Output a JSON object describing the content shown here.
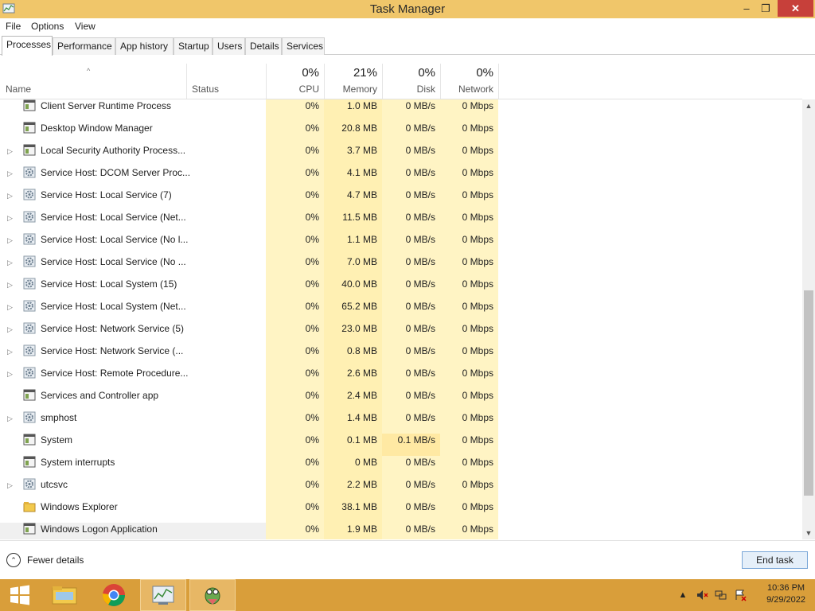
{
  "window": {
    "title": "Task Manager",
    "controls": {
      "minimize": "–",
      "maximize": "❐",
      "close": "✕"
    }
  },
  "menu": [
    "File",
    "Options",
    "View"
  ],
  "tabs": [
    "Processes",
    "Performance",
    "App history",
    "Startup",
    "Users",
    "Details",
    "Services"
  ],
  "columns": {
    "name": "Name",
    "status": "Status",
    "cpu": {
      "pct": "0%",
      "label": "CPU"
    },
    "memory": {
      "pct": "21%",
      "label": "Memory"
    },
    "disk": {
      "pct": "0%",
      "label": "Disk"
    },
    "network": {
      "pct": "0%",
      "label": "Network"
    }
  },
  "processes": [
    {
      "name": "Client Server Runtime Process",
      "cpu": "0%",
      "memory": "1.0 MB",
      "disk": "0 MB/s",
      "network": "0 Mbps",
      "expandable": false,
      "icon": "window-app-icon"
    },
    {
      "name": "Desktop Window Manager",
      "cpu": "0%",
      "memory": "20.8 MB",
      "disk": "0 MB/s",
      "network": "0 Mbps",
      "expandable": false,
      "icon": "window-app-icon"
    },
    {
      "name": "Local Security Authority Process...",
      "cpu": "0%",
      "memory": "3.7 MB",
      "disk": "0 MB/s",
      "network": "0 Mbps",
      "expandable": true,
      "icon": "window-app-icon"
    },
    {
      "name": "Service Host: DCOM Server Proc...",
      "cpu": "0%",
      "memory": "4.1 MB",
      "disk": "0 MB/s",
      "network": "0 Mbps",
      "expandable": true,
      "icon": "gear-icon"
    },
    {
      "name": "Service Host: Local Service (7)",
      "cpu": "0%",
      "memory": "4.7 MB",
      "disk": "0 MB/s",
      "network": "0 Mbps",
      "expandable": true,
      "icon": "gear-icon"
    },
    {
      "name": "Service Host: Local Service (Net...",
      "cpu": "0%",
      "memory": "11.5 MB",
      "disk": "0 MB/s",
      "network": "0 Mbps",
      "expandable": true,
      "icon": "gear-icon"
    },
    {
      "name": "Service Host: Local Service (No l...",
      "cpu": "0%",
      "memory": "1.1 MB",
      "disk": "0 MB/s",
      "network": "0 Mbps",
      "expandable": true,
      "icon": "gear-icon"
    },
    {
      "name": "Service Host: Local Service (No ...",
      "cpu": "0%",
      "memory": "7.0 MB",
      "disk": "0 MB/s",
      "network": "0 Mbps",
      "expandable": true,
      "icon": "gear-icon"
    },
    {
      "name": "Service Host: Local System (15)",
      "cpu": "0%",
      "memory": "40.0 MB",
      "disk": "0 MB/s",
      "network": "0 Mbps",
      "expandable": true,
      "icon": "gear-icon"
    },
    {
      "name": "Service Host: Local System (Net...",
      "cpu": "0%",
      "memory": "65.2 MB",
      "disk": "0 MB/s",
      "network": "0 Mbps",
      "expandable": true,
      "icon": "gear-icon"
    },
    {
      "name": "Service Host: Network Service (5)",
      "cpu": "0%",
      "memory": "23.0 MB",
      "disk": "0 MB/s",
      "network": "0 Mbps",
      "expandable": true,
      "icon": "gear-icon"
    },
    {
      "name": "Service Host: Network Service (...",
      "cpu": "0%",
      "memory": "0.8 MB",
      "disk": "0 MB/s",
      "network": "0 Mbps",
      "expandable": true,
      "icon": "gear-icon"
    },
    {
      "name": "Service Host: Remote Procedure...",
      "cpu": "0%",
      "memory": "2.6 MB",
      "disk": "0 MB/s",
      "network": "0 Mbps",
      "expandable": true,
      "icon": "gear-icon"
    },
    {
      "name": "Services and Controller app",
      "cpu": "0%",
      "memory": "2.4 MB",
      "disk": "0 MB/s",
      "network": "0 Mbps",
      "expandable": false,
      "icon": "window-app-icon"
    },
    {
      "name": "smphost",
      "cpu": "0%",
      "memory": "1.4 MB",
      "disk": "0 MB/s",
      "network": "0 Mbps",
      "expandable": true,
      "icon": "gear-icon"
    },
    {
      "name": "System",
      "cpu": "0%",
      "memory": "0.1 MB",
      "disk": "0.1 MB/s",
      "network": "0 Mbps",
      "expandable": false,
      "icon": "window-app-icon"
    },
    {
      "name": "System interrupts",
      "cpu": "0%",
      "memory": "0 MB",
      "disk": "0 MB/s",
      "network": "0 Mbps",
      "expandable": false,
      "icon": "window-app-icon"
    },
    {
      "name": "utcsvc",
      "cpu": "0%",
      "memory": "2.2 MB",
      "disk": "0 MB/s",
      "network": "0 Mbps",
      "expandable": true,
      "icon": "gear-icon"
    },
    {
      "name": "Windows Explorer",
      "cpu": "0%",
      "memory": "38.1 MB",
      "disk": "0 MB/s",
      "network": "0 Mbps",
      "expandable": false,
      "icon": "folder-icon"
    },
    {
      "name": "Windows Logon Application",
      "cpu": "0%",
      "memory": "1.9 MB",
      "disk": "0 MB/s",
      "network": "0 Mbps",
      "expandable": false,
      "icon": "window-app-icon",
      "selected": true
    }
  ],
  "footer": {
    "fewer_details": "Fewer details",
    "end_task": "End task"
  },
  "taskbar": {
    "apps": [
      "start-icon",
      "file-explorer-icon",
      "chrome-icon",
      "task-manager-icon",
      "bug-tool-icon"
    ],
    "time": "10:36 PM",
    "date": "9/29/2022"
  },
  "colors": {
    "titlebar": "#f0c66a",
    "taskbar": "#d99e3a",
    "heat_light": "#fff4c4",
    "heat_medium": "#fff0b3",
    "close": "#c7403a"
  }
}
